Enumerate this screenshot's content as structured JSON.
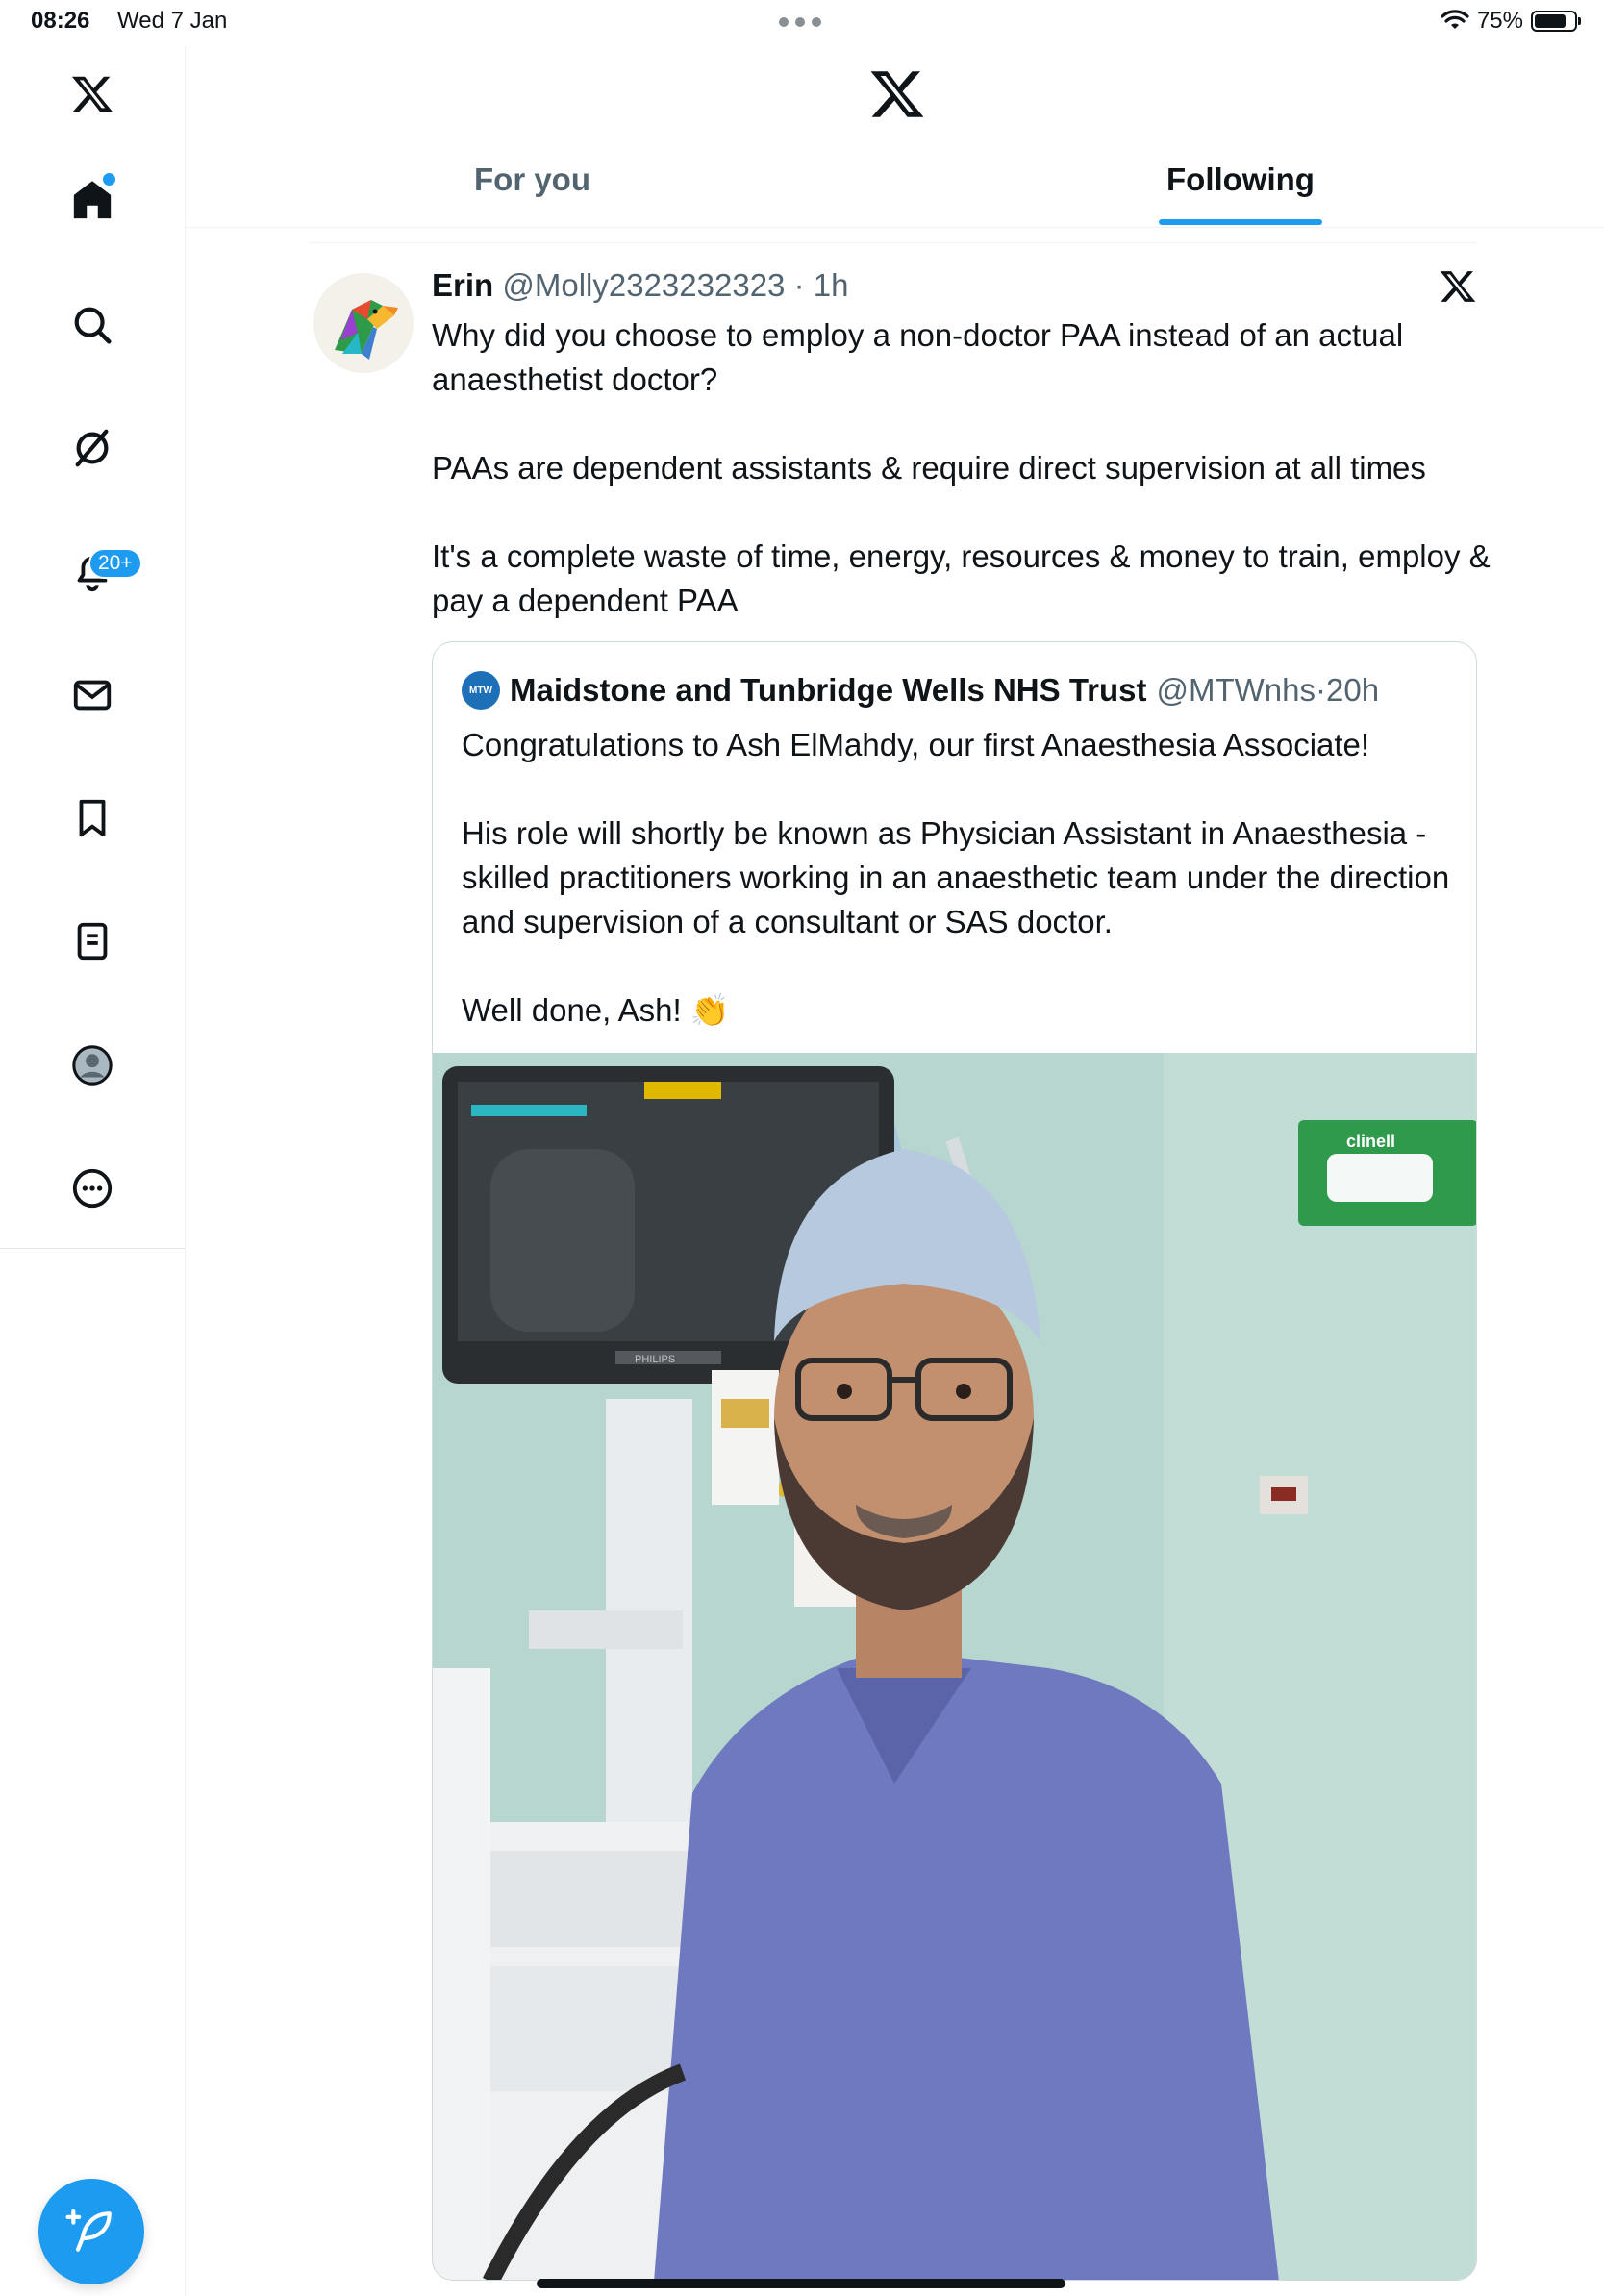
{
  "status_bar": {
    "time": "08:26",
    "date": "Wed 7 Jan",
    "battery": "75%"
  },
  "sidebar": {
    "items": [
      {
        "name": "home",
        "active": true,
        "has_dot": true
      },
      {
        "name": "search"
      },
      {
        "name": "grok"
      },
      {
        "name": "notifications",
        "badge": "20+"
      },
      {
        "name": "messages"
      },
      {
        "name": "bookmarks"
      },
      {
        "name": "lists"
      },
      {
        "name": "profile"
      },
      {
        "name": "more"
      }
    ],
    "compose_icon": "feather-plus-icon"
  },
  "header": {
    "tabs": [
      {
        "label": "For you",
        "active": false
      },
      {
        "label": "Following",
        "active": true
      }
    ]
  },
  "tweet": {
    "name": "Erin",
    "handle": "@Molly2323232323",
    "time": "1h",
    "paragraphs": [
      "Why did you choose to employ a non-doctor PAA instead of an actual anaesthetist doctor?",
      "PAAs are dependent assistants & require direct supervision at all times",
      "It's a complete waste of time, energy, resources & money to train, employ & pay a dependent PAA"
    ],
    "quote": {
      "logo_text": "MTW",
      "name": "Maidstone and Tunbridge Wells NHS Trust",
      "handle": "@MTWnhs",
      "time": "20h",
      "paragraphs": [
        "Congratulations to Ash ElMahdy, our first Anaesthesia Associate!",
        "His role will shortly be known as Physician Assistant in Anaesthesia - skilled practitioners working in an anaesthetic team under the direction and supervision of a consultant or SAS doctor.",
        "Well done, Ash! 👏"
      ],
      "image_labels": {
        "monitor_brand": "PHILIPS",
        "wipes_brand": "clinell"
      }
    }
  },
  "colors": {
    "accent": "#1d9bf0",
    "text": "#0f1419",
    "muted": "#536471",
    "border": "#cfd9de"
  }
}
